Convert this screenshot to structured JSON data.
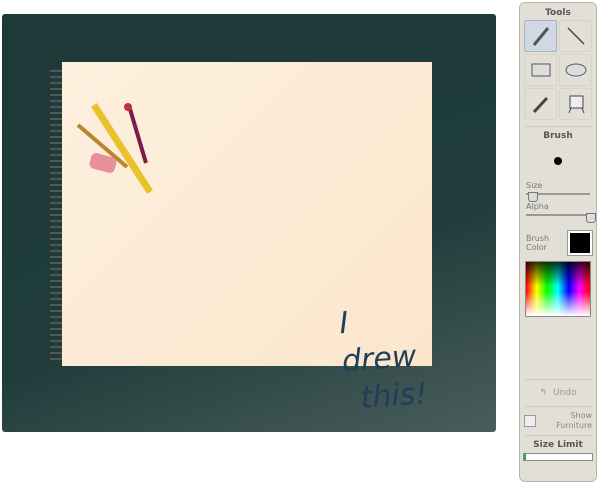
{
  "canvas": {
    "drawing_text": [
      "I drew",
      "this!"
    ]
  },
  "panel": {
    "tools_title": "Tools",
    "tools": [
      {
        "name": "brush",
        "selected": true
      },
      {
        "name": "line"
      },
      {
        "name": "rectangle"
      },
      {
        "name": "ellipse"
      },
      {
        "name": "eyedropper"
      },
      {
        "name": "easel"
      }
    ],
    "brush_title": "Brush",
    "size_label": "Size",
    "size_value": 0.1,
    "alpha_label": "Alpha",
    "alpha_value": 1.0,
    "brush_color_label": "Brush Color",
    "brush_color": "#000000",
    "undo_label": "Undo",
    "show_furniture_label": "Show Furniture",
    "show_furniture_checked": false,
    "size_limit_label": "Size Limit",
    "size_limit_fraction": 0.03
  }
}
